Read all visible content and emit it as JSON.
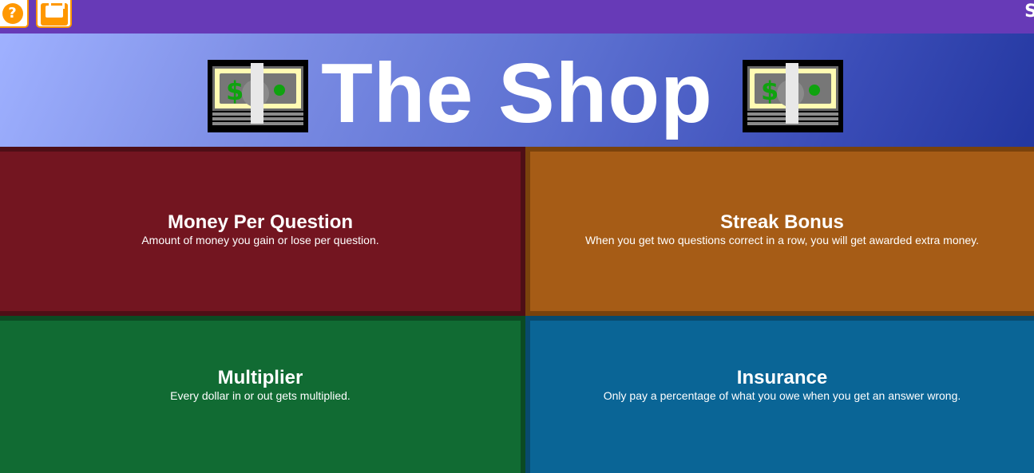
{
  "topbar": {
    "help_icon": "question-mark-icon",
    "shop_icon": "shopping-bag-icon",
    "corner_text": "S",
    "colors": {
      "bar": "#673ab7",
      "accent": "#ff9800"
    }
  },
  "banner": {
    "title": "The Shop",
    "decor_icon": "money-bill-icon"
  },
  "upgrades": [
    {
      "name": "Money Per Question",
      "description": "Amount of money you gain or lose per question.",
      "color": "#731520"
    },
    {
      "name": "Streak Bonus",
      "description": "When you get two questions correct in a row, you will get awarded extra money.",
      "color": "#a65c16"
    },
    {
      "name": "Multiplier",
      "description": "Every dollar in or out gets multiplied.",
      "color": "#116b33"
    },
    {
      "name": "Insurance",
      "description": "Only pay a percentage of what you owe when you get an answer wrong.",
      "color": "#0a6596"
    }
  ]
}
